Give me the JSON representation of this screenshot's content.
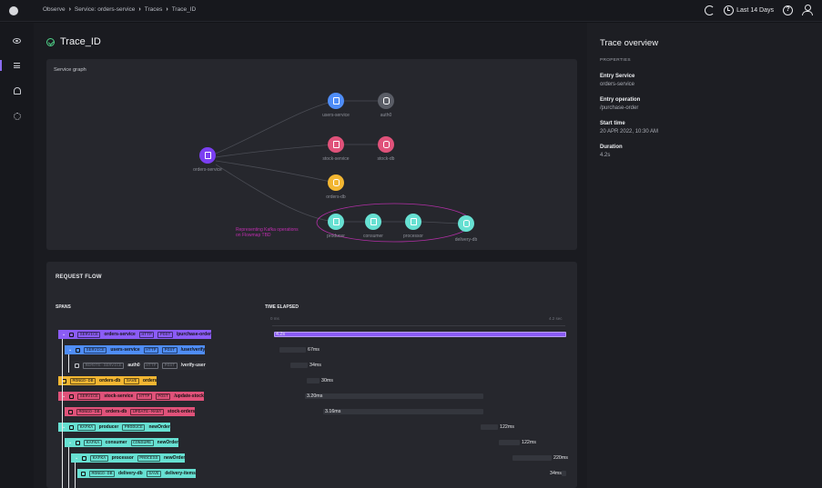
{
  "breadcrumbs": [
    "Observe",
    "Service: orders-service",
    "Traces",
    "Trace_ID"
  ],
  "topbar": {
    "time_range": "Last 14 Days",
    "help_glyph": "?"
  },
  "sidebar": {
    "items": [
      {
        "icon": "eye-icon"
      },
      {
        "icon": "list-icon",
        "active": true
      },
      {
        "icon": "bell-icon"
      },
      {
        "icon": "gear-icon"
      }
    ]
  },
  "page": {
    "title": "Trace_ID"
  },
  "graph": {
    "label": "Service graph",
    "nodes": {
      "orders_service": "orders-service",
      "users_service": "users-service",
      "auth0": "auth0",
      "stock_service": "stock-service",
      "stock_db": "stock-db",
      "orders_db": "orders-db",
      "producer": "producer",
      "consumer": "consumer",
      "processor": "processor",
      "delivery_db": "delivery-db"
    },
    "kafka_note": [
      "Representing Kafka operations",
      "on Flowmap TBD"
    ]
  },
  "flow": {
    "title": "REQUEST FLOW",
    "spans_header": "SPANS",
    "time_header": "TIME ELAPSED",
    "axis_min": "0 ms",
    "axis_max": "4.2 sec",
    "spans": [
      {
        "kind": "SERVICE",
        "name": "orders-service",
        "protocol": "HTTP",
        "method": "POST",
        "resource": "/purchase-order",
        "time": "4.2s",
        "color": "#8b5cf6"
      },
      {
        "kind": "SERVICE",
        "name": "users-service",
        "protocol": "HTTP",
        "method": "POST",
        "resource": "/user/verify",
        "time": "67ms",
        "color": "#4f8df7"
      },
      {
        "kind": "REMOTE-SERVICE",
        "name": "auth0",
        "protocol": "HTTP",
        "method": "POST",
        "resource": "/verify-user",
        "time": "34ms",
        "color": "#2a2b31"
      },
      {
        "kind": "MONGO-DB",
        "name": "orders-db",
        "protocol": "",
        "method": "SAVE",
        "resource": "orders",
        "time": "30ms",
        "color": "#f2b632"
      },
      {
        "kind": "SERVICE",
        "name": "stock-service",
        "protocol": "HTTP",
        "method": "POST",
        "resource": "/update-stock",
        "time": "3.20ms",
        "color": "#e0527a"
      },
      {
        "kind": "MONGO-DB",
        "name": "orders-db",
        "protocol": "",
        "method": "UPDATE-MANY",
        "resource": "stock-orders",
        "time": "3.16ms",
        "color": "#e0527a"
      },
      {
        "kind": "KAFKA",
        "name": "producer",
        "protocol": "",
        "method": "PRODUCE",
        "resource": "newOrder",
        "time": "122ms",
        "color": "#67e0d2"
      },
      {
        "kind": "KAFKA",
        "name": "consumer",
        "protocol": "",
        "method": "CONSUME",
        "resource": "newOrder",
        "time": "122ms",
        "color": "#67e0d2"
      },
      {
        "kind": "KAFKA",
        "name": "processor",
        "protocol": "",
        "method": "PROCESS",
        "resource": "newOrder",
        "time": "220ms",
        "color": "#67e0d2"
      },
      {
        "kind": "MONGO-DB",
        "name": "delivery-db",
        "protocol": "",
        "method": "SAVE",
        "resource": "delivery-items",
        "time": "34ms",
        "color": "#67e0d2"
      }
    ]
  },
  "overview": {
    "title": "Trace overview",
    "section": "PROPERTIES",
    "entry_service_label": "Entry Service",
    "entry_service": "orders-service",
    "entry_operation_label": "Entry operation",
    "entry_operation": "/purchase-order",
    "start_time_label": "Start time",
    "start_time": "20 APR 2022, 10:30 AM",
    "duration_label": "Duration",
    "duration": "4.2s"
  },
  "colors": {
    "accent": "#8b5cf6",
    "kafka": "#67e0d2",
    "stock": "#e0527a",
    "users": "#4f8df7",
    "orders_db": "#f2b632",
    "kafka_note": "#c12eb0"
  }
}
